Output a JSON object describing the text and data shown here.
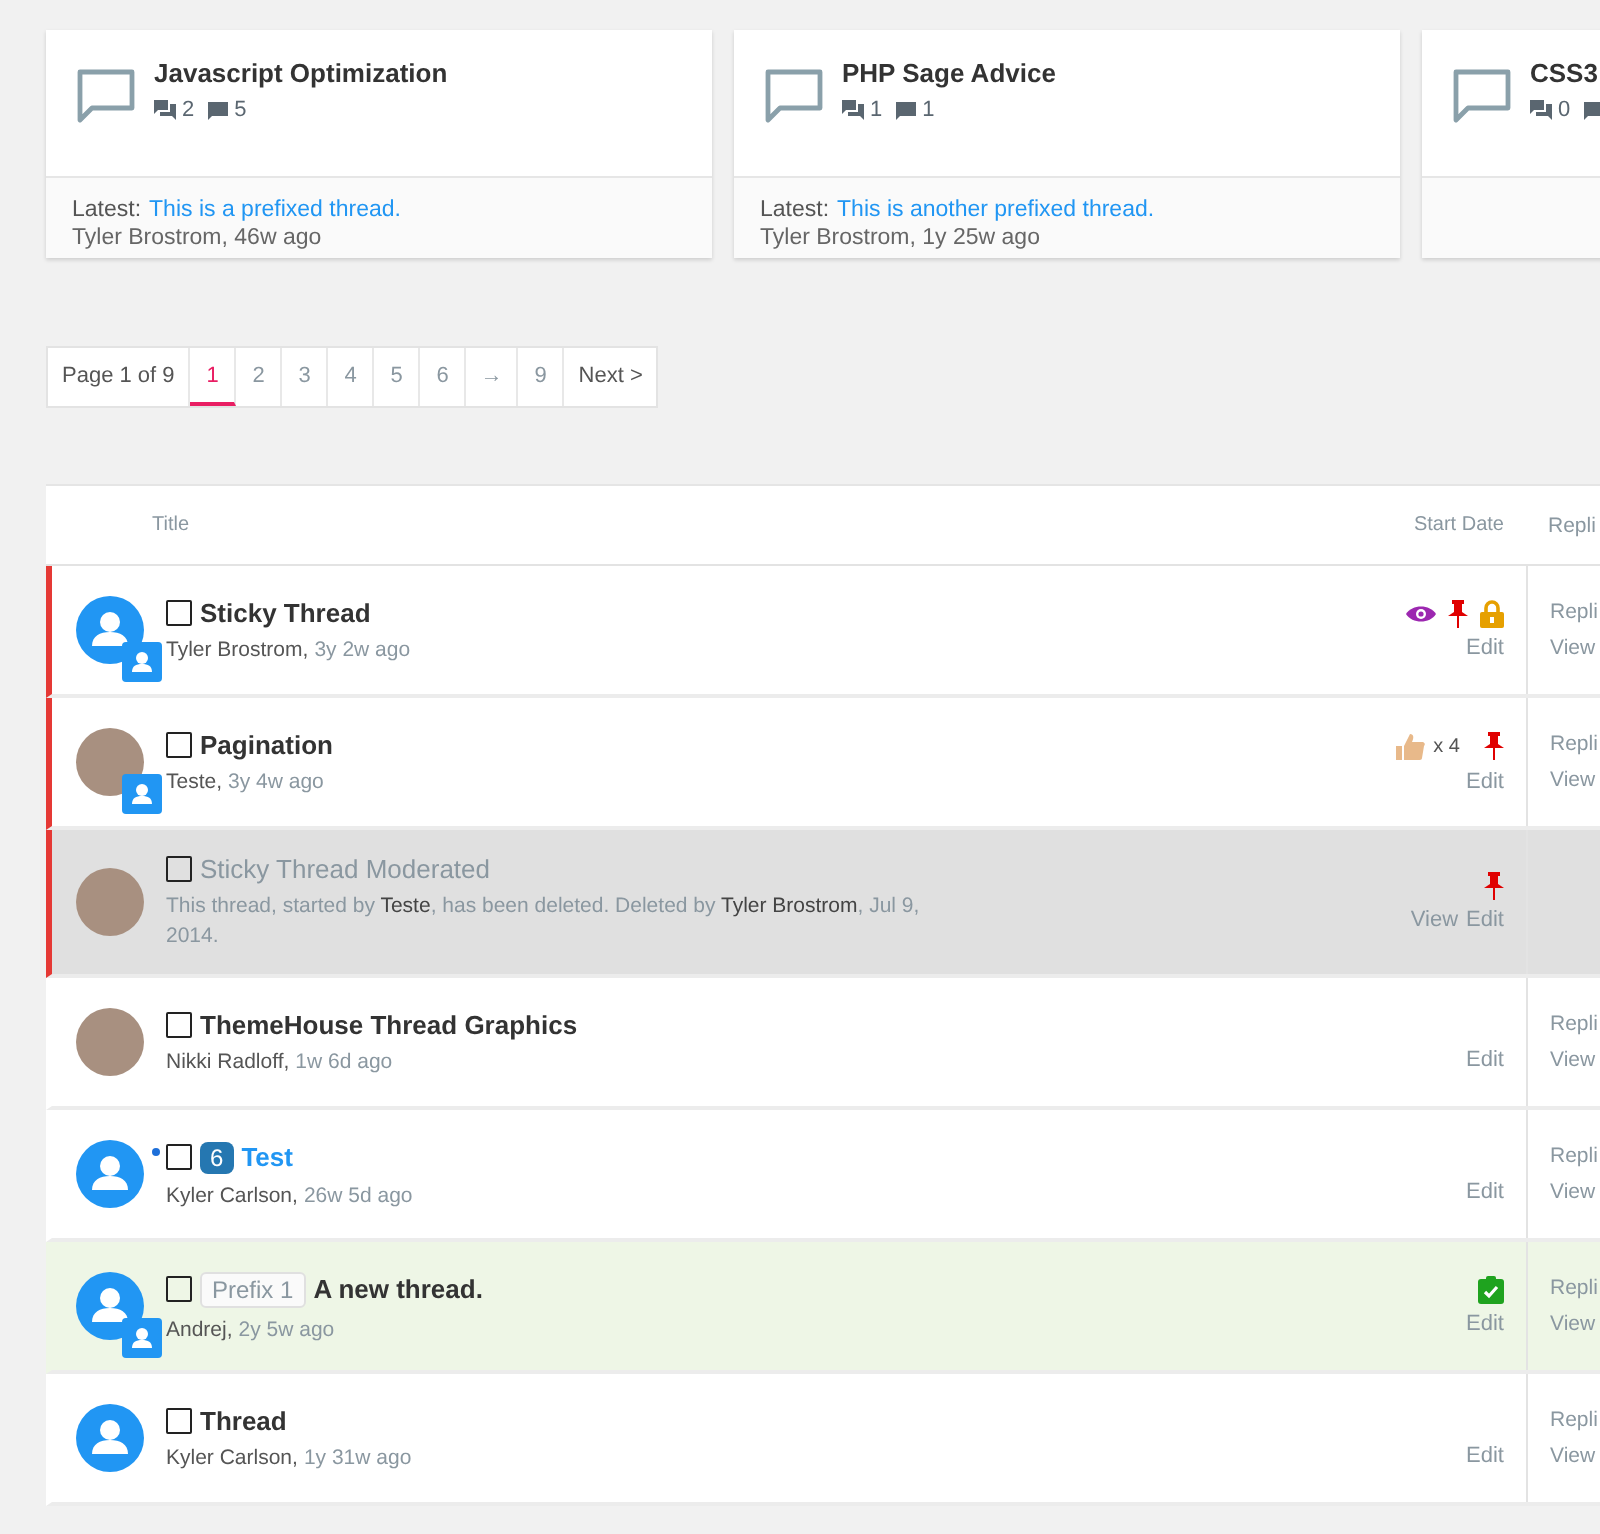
{
  "forum_cards": [
    {
      "title": "Javascript Optimization",
      "threads": "2",
      "messages": "5",
      "latest_label": "Latest:",
      "latest_link": "This is a prefixed thread.",
      "latest_meta": "Tyler Brostrom, 46w ago"
    },
    {
      "title": "PHP Sage Advice",
      "threads": "1",
      "messages": "1",
      "latest_label": "Latest:",
      "latest_link": "This is another prefixed thread.",
      "latest_meta": "Tyler Brostrom, 1y 25w ago"
    },
    {
      "title": "CSS3",
      "threads": "0"
    }
  ],
  "pagination": {
    "label": "Page 1 of 9",
    "pages": [
      {
        "text": "1",
        "selected": true
      },
      {
        "text": "2",
        "selected": false
      },
      {
        "text": "3",
        "selected": false
      },
      {
        "text": "4",
        "selected": false
      },
      {
        "text": "5",
        "selected": false
      },
      {
        "text": "6",
        "selected": false
      },
      {
        "text": "→",
        "selected": false
      },
      {
        "text": "9",
        "selected": false
      }
    ],
    "next": "Next >"
  },
  "table": {
    "columns": [
      "Title",
      "Start Date",
      "Repli"
    ],
    "rows": [
      {
        "title": "Sticky Thread",
        "author": "Tyler Brostrom,",
        "time": "3y 2w ago",
        "avatar": {
          "kind": "default",
          "badge": true
        },
        "sticky": true,
        "deleted": false,
        "moderated": false,
        "unread": false,
        "icons": [
          {
            "kind": "eye"
          },
          {
            "kind": "pin"
          },
          {
            "kind": "lock"
          }
        ],
        "actions": [
          "Edit"
        ],
        "stats": [
          "Repli",
          "View"
        ]
      },
      {
        "title": "Pagination",
        "author": "Teste,",
        "time": "3y 4w ago",
        "avatar": {
          "kind": "photo",
          "badge": true
        },
        "sticky": true,
        "deleted": false,
        "moderated": false,
        "unread": false,
        "likes": "x 4",
        "icons": [
          {
            "kind": "pin"
          }
        ],
        "actions": [
          "Edit"
        ],
        "stats": [
          "Repli",
          "View"
        ]
      },
      {
        "title": "Sticky Thread Moderated",
        "message": "This thread, started by **Teste**, has been deleted. Deleted by **Tyler Brostrom**, Jul 9, 2014.",
        "avatar": {
          "kind": "photo",
          "badge": false
        },
        "sticky": true,
        "deleted": true,
        "moderated": false,
        "unread": false,
        "icons": [
          {
            "kind": "pin"
          }
        ],
        "actions": [
          "View",
          "Edit"
        ],
        "stats": []
      },
      {
        "title": "ThemeHouse Thread Graphics",
        "author": "Nikki Radloff,",
        "time": "1w 6d ago",
        "avatar": {
          "kind": "photo",
          "badge": false
        },
        "sticky": false,
        "deleted": false,
        "moderated": false,
        "unread": false,
        "icons": [],
        "actions": [
          "Edit"
        ],
        "stats": [
          "Repli",
          "View"
        ]
      },
      {
        "title": "Test",
        "author": "Kyler Carlson,",
        "time": "26w 5d ago",
        "avatar": {
          "kind": "default",
          "badge": false
        },
        "prefix": {
          "kind": "count",
          "text": "6"
        },
        "sticky": false,
        "deleted": false,
        "moderated": false,
        "unread": true,
        "icons": [],
        "actions": [
          "Edit"
        ],
        "stats": [
          "Repli",
          "View"
        ]
      },
      {
        "title": "A new thread.",
        "author": "Andrej,",
        "time": "2y 5w ago",
        "avatar": {
          "kind": "default",
          "badge": true
        },
        "prefix": {
          "kind": "label",
          "text": "Prefix 1"
        },
        "sticky": false,
        "deleted": false,
        "moderated": true,
        "unread": false,
        "icons": [
          {
            "kind": "approved"
          }
        ],
        "actions": [
          "Edit"
        ],
        "stats": [
          "Repli",
          "View"
        ]
      },
      {
        "title": "Thread",
        "author": "Kyler Carlson,",
        "time": "1y 31w ago",
        "avatar": {
          "kind": "default",
          "badge": false
        },
        "sticky": false,
        "deleted": false,
        "moderated": false,
        "unread": false,
        "icons": [],
        "actions": [
          "Edit"
        ],
        "stats": [
          "Repli",
          "View"
        ]
      }
    ]
  }
}
